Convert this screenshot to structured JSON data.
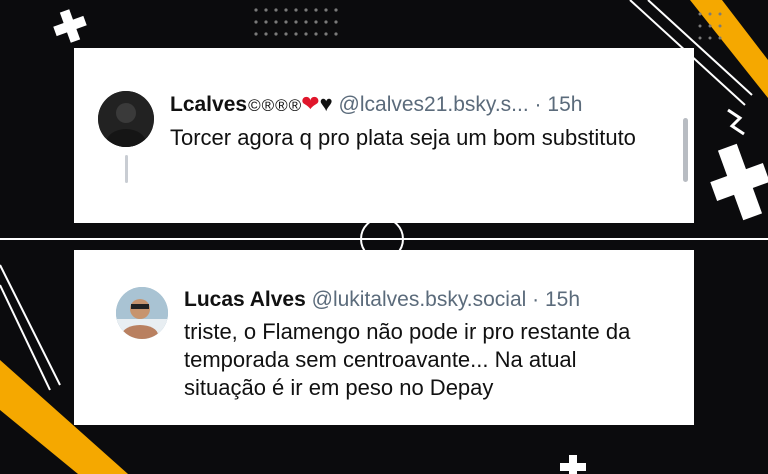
{
  "colors": {
    "background": "#0b0b0d",
    "accent": "#f5a800",
    "card": "#ffffff",
    "muted_text": "#5b6b7b",
    "heart_red": "#e0162b"
  },
  "posts": [
    {
      "name": "Lcalves",
      "badges": [
        "©",
        "®",
        "®",
        "®"
      ],
      "handle": "@lcalves21.bsky.s...",
      "separator": "·",
      "time": "15h",
      "text": "Torcer agora q pro plata seja um bom substituto",
      "avatar_icon": "avatar-dark"
    },
    {
      "name": "Lucas Alves",
      "handle": "@lukitalves.bsky.social",
      "separator": "·",
      "time": "15h",
      "text": "triste, o Flamengo não pode ir pro restante da temporada sem centroavante... Na atual situação é ir em peso no Depay",
      "avatar_icon": "avatar-photo"
    }
  ]
}
